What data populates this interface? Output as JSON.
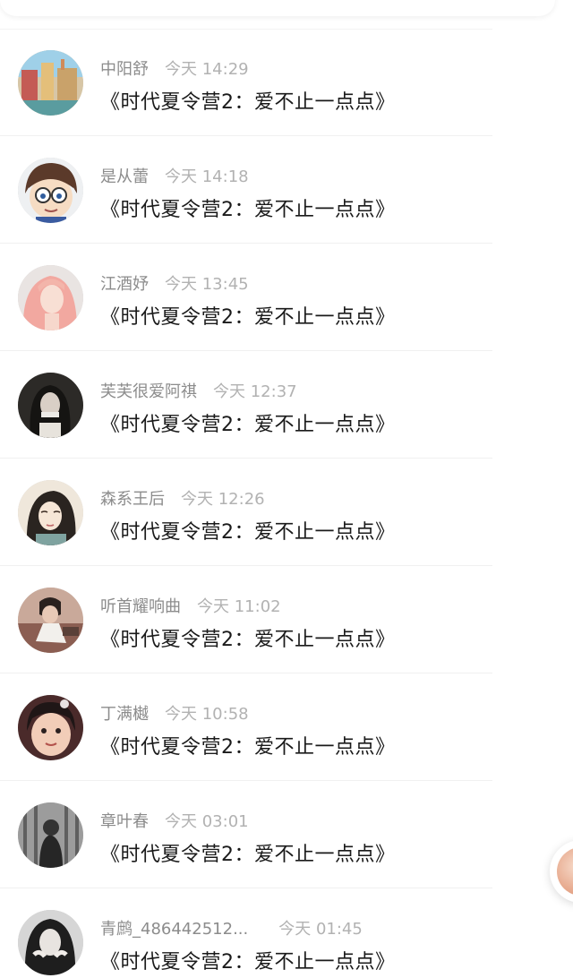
{
  "items": [
    {
      "name": "中阳舒",
      "time": "今天 14:29",
      "title": "《时代夏令营2：爱不止一点点》"
    },
    {
      "name": "是从蕾",
      "time": "今天 14:18",
      "title": "《时代夏令营2：爱不止一点点》"
    },
    {
      "name": "江酒妤",
      "time": "今天 13:45",
      "title": "《时代夏令营2：爱不止一点点》"
    },
    {
      "name": "芙芙很爱阿祺",
      "time": "今天 12:37",
      "title": "《时代夏令营2：爱不止一点点》"
    },
    {
      "name": "森系王后",
      "time": "今天 12:26",
      "title": "《时代夏令营2：爱不止一点点》"
    },
    {
      "name": "听首耀响曲",
      "time": "今天 11:02",
      "title": "《时代夏令营2：爱不止一点点》"
    },
    {
      "name": "丁满樾",
      "time": "今天 10:58",
      "title": "《时代夏令营2：爱不止一点点》"
    },
    {
      "name": "章叶春",
      "time": "今天 03:01",
      "title": "《时代夏令营2：爱不止一点点》"
    },
    {
      "name": "青鹧_486442512...",
      "time": "今天 01:45",
      "title": "《时代夏令营2：爱不止一点点》"
    }
  ]
}
